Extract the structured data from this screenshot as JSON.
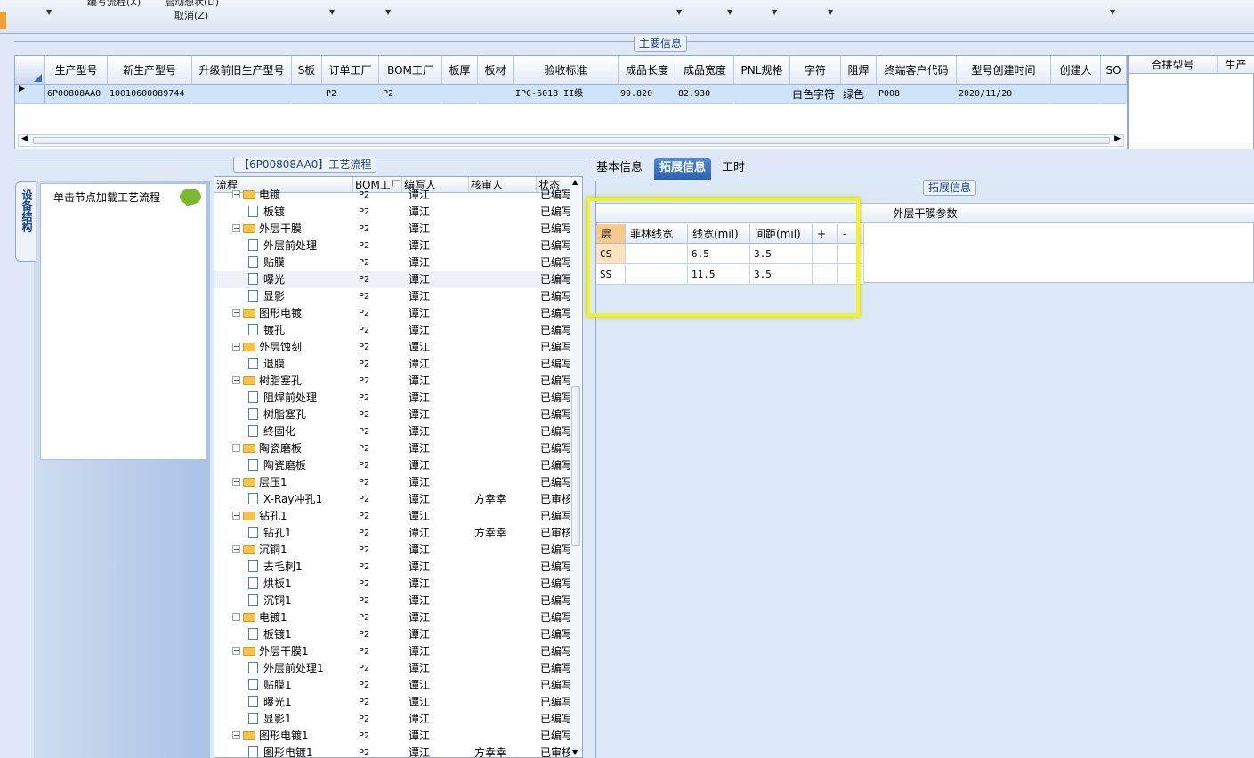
{
  "menu": {
    "cancel": "取消(Z)",
    "partial_left": "编写流程(X)",
    "partial_right": "启动想状(D)"
  },
  "main_info": {
    "title": "主要信息",
    "columns": [
      "生产型号",
      "新生产型号",
      "升级前旧生产型号",
      "S板",
      "订单工厂",
      "BOM工厂",
      "板厚",
      "板材",
      "验收标准",
      "成品长度",
      "成品宽度",
      "PNL规格",
      "字符",
      "阻焊",
      "终端客户代码",
      "型号创建时间",
      "创建人",
      "SO"
    ],
    "row": [
      "6P00808AA0",
      "10010600089744",
      "",
      "",
      "P2",
      "P2",
      "",
      "",
      "IPC-6018 II级",
      "99.820",
      "82.930",
      "",
      "白色字符",
      "绿色",
      "P008",
      "2020/11/20",
      "",
      ""
    ],
    "right_columns": [
      "合拼型号",
      "生产"
    ]
  },
  "process": {
    "title": "【6P00808AA0】工艺流程",
    "side_tab": "设备结构",
    "node_hint": "单击节点加载工艺流程",
    "columns": [
      "流程",
      "BOM工厂",
      "编写人",
      "核审人",
      "状态"
    ],
    "rows": [
      {
        "name": "电镀",
        "type": "folder",
        "factory": "P2",
        "author": "谭江",
        "reviewer": "",
        "status": "已编写"
      },
      {
        "name": "板镀",
        "type": "file",
        "factory": "P2",
        "author": "谭江",
        "reviewer": "",
        "status": "已编写"
      },
      {
        "name": "外层干膜",
        "type": "folder",
        "factory": "P2",
        "author": "谭江",
        "reviewer": "",
        "status": "已编写"
      },
      {
        "name": "外层前处理",
        "type": "file",
        "factory": "P2",
        "author": "谭江",
        "reviewer": "",
        "status": "已编写"
      },
      {
        "name": "贴膜",
        "type": "file",
        "factory": "P2",
        "author": "谭江",
        "reviewer": "",
        "status": "已编写"
      },
      {
        "name": "曝光",
        "type": "file",
        "factory": "P2",
        "author": "谭江",
        "reviewer": "",
        "status": "已编写"
      },
      {
        "name": "显影",
        "type": "file",
        "factory": "P2",
        "author": "谭江",
        "reviewer": "",
        "status": "已编写"
      },
      {
        "name": "图形电镀",
        "type": "folder",
        "factory": "P2",
        "author": "谭江",
        "reviewer": "",
        "status": "已编写"
      },
      {
        "name": "镀孔",
        "type": "file",
        "factory": "P2",
        "author": "谭江",
        "reviewer": "",
        "status": "已编写"
      },
      {
        "name": "外层蚀刻",
        "type": "folder",
        "factory": "P2",
        "author": "谭江",
        "reviewer": "",
        "status": "已编写"
      },
      {
        "name": "退膜",
        "type": "file",
        "factory": "P2",
        "author": "谭江",
        "reviewer": "",
        "status": "已编写"
      },
      {
        "name": "树脂塞孔",
        "type": "folder",
        "factory": "P2",
        "author": "谭江",
        "reviewer": "",
        "status": "已编写"
      },
      {
        "name": "阻焊前处理",
        "type": "file",
        "factory": "P2",
        "author": "谭江",
        "reviewer": "",
        "status": "已编写"
      },
      {
        "name": "树脂塞孔",
        "type": "file",
        "factory": "P2",
        "author": "谭江",
        "reviewer": "",
        "status": "已编写"
      },
      {
        "name": "终固化",
        "type": "file",
        "factory": "P2",
        "author": "谭江",
        "reviewer": "",
        "status": "已编写"
      },
      {
        "name": "陶瓷磨板",
        "type": "folder",
        "factory": "P2",
        "author": "谭江",
        "reviewer": "",
        "status": "已编写"
      },
      {
        "name": "陶瓷磨板",
        "type": "file",
        "factory": "P2",
        "author": "谭江",
        "reviewer": "",
        "status": "已编写"
      },
      {
        "name": "层压1",
        "type": "folder",
        "factory": "P2",
        "author": "谭江",
        "reviewer": "",
        "status": "已编写"
      },
      {
        "name": "X-Ray冲孔1",
        "type": "file",
        "factory": "P2",
        "author": "谭江",
        "reviewer": "方幸幸",
        "status": "已审核"
      },
      {
        "name": "钻孔1",
        "type": "folder",
        "factory": "P2",
        "author": "谭江",
        "reviewer": "",
        "status": "已编写"
      },
      {
        "name": "钻孔1",
        "type": "file",
        "factory": "P2",
        "author": "谭江",
        "reviewer": "方幸幸",
        "status": "已审核"
      },
      {
        "name": "沉铜1",
        "type": "folder",
        "factory": "P2",
        "author": "谭江",
        "reviewer": "",
        "status": "已编写"
      },
      {
        "name": "去毛刺1",
        "type": "file",
        "factory": "P2",
        "author": "谭江",
        "reviewer": "",
        "status": "已编写"
      },
      {
        "name": "烘板1",
        "type": "file",
        "factory": "P2",
        "author": "谭江",
        "reviewer": "",
        "status": "已编写"
      },
      {
        "name": "沉铜1",
        "type": "file",
        "factory": "P2",
        "author": "谭江",
        "reviewer": "",
        "status": "已编写"
      },
      {
        "name": "电镀1",
        "type": "folder",
        "factory": "P2",
        "author": "谭江",
        "reviewer": "",
        "status": "已编写"
      },
      {
        "name": "板镀1",
        "type": "file",
        "factory": "P2",
        "author": "谭江",
        "reviewer": "",
        "status": "已编写"
      },
      {
        "name": "外层干膜1",
        "type": "folder",
        "factory": "P2",
        "author": "谭江",
        "reviewer": "",
        "status": "已编写"
      },
      {
        "name": "外层前处理1",
        "type": "file",
        "factory": "P2",
        "author": "谭江",
        "reviewer": "",
        "status": "已编写"
      },
      {
        "name": "贴膜1",
        "type": "file",
        "factory": "P2",
        "author": "谭江",
        "reviewer": "",
        "status": "已编写"
      },
      {
        "name": "曝光1",
        "type": "file",
        "factory": "P2",
        "author": "谭江",
        "reviewer": "",
        "status": "已编写"
      },
      {
        "name": "显影1",
        "type": "file",
        "factory": "P2",
        "author": "谭江",
        "reviewer": "",
        "status": "已编写"
      },
      {
        "name": "图形电镀1",
        "type": "folder",
        "factory": "P2",
        "author": "谭江",
        "reviewer": "",
        "status": "已编写"
      },
      {
        "name": "图形电镀1",
        "type": "file",
        "factory": "P2",
        "author": "谭江",
        "reviewer": "方幸幸",
        "status": "已审核"
      }
    ]
  },
  "tabs": {
    "basic": "基本信息",
    "extended": "拓展信息",
    "hours": "工时"
  },
  "extended": {
    "title": "拓展信息",
    "grid_title": "外层干膜参数",
    "columns": [
      "层",
      "菲林线宽",
      "线宽(mil)",
      "间距(mil)",
      "+",
      "-"
    ],
    "rows": [
      [
        "CS",
        "",
        "6.5",
        "3.5"
      ],
      [
        "SS",
        "",
        "11.5",
        "3.5"
      ]
    ]
  }
}
